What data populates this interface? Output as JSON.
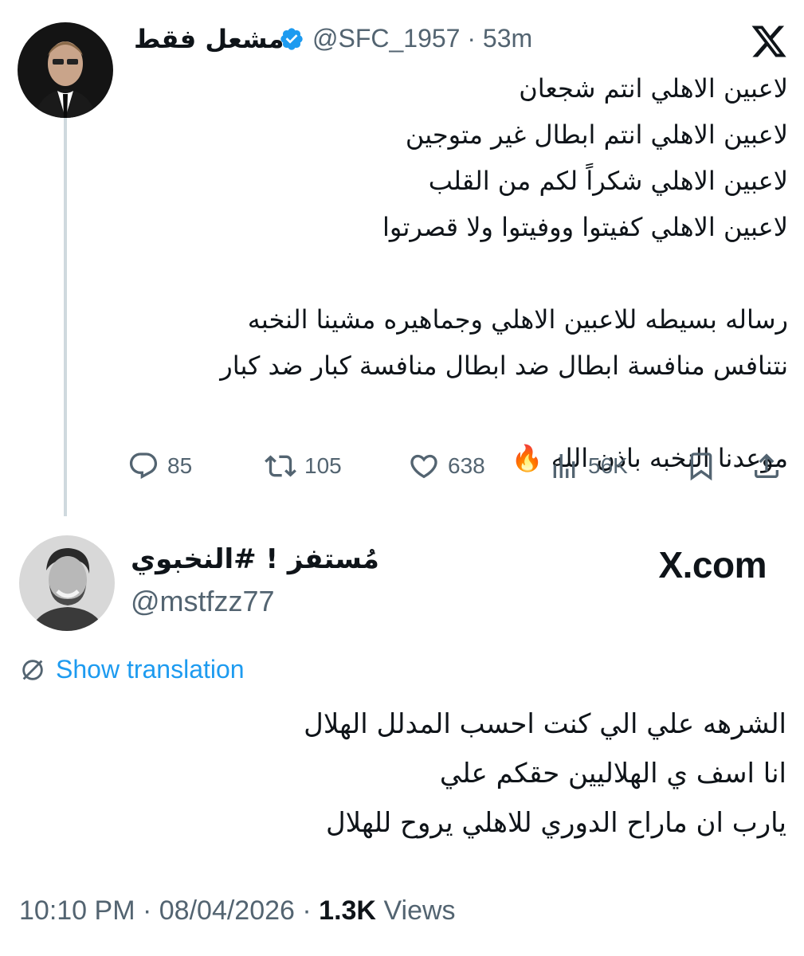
{
  "quoted_tweet": {
    "author_name": "مشعل فقط",
    "handle": "@SFC_1957",
    "separator": "·",
    "time": "53m",
    "text": "لاعبين الاهلي انتم شجعان\nلاعبين الاهلي انتم ابطال غير متوجين\nلاعبين الاهلي شكراً لكم من القلب\nلاعبين الاهلي كفيتوا ووفيتوا ولا قصرتوا\n\nرساله بسيطه للاعبين الاهلي وجماهيره مشينا النخبه\nنتنافس منافسة ابطال ضد ابطال منافسة كبار ضد كبار\n\nموعدنا النخبه باذن الله 🔥",
    "stats": {
      "replies": "85",
      "reposts": "105",
      "likes": "638",
      "views": "56K"
    }
  },
  "reply_tweet": {
    "author_name": "مُستفز ! #النخبوي",
    "handle": "@mstfzz77",
    "brand": "X.com",
    "translate_label": "Show translation",
    "text": "الشرهه علي الي كنت احسب المدلل الهلال\nانا اسف ي الهلاليين حقكم علي\nيارب ان ماراح الدوري للاهلي يروح للهلال",
    "time": "10:10 PM",
    "separator": "·",
    "date": "08/04/2026",
    "views_count": "1.3K",
    "views_label": "Views"
  },
  "colors": {
    "text": "#0f1419",
    "muted": "#536471",
    "accent": "#1d9bf0",
    "thread_line": "#cfd9de"
  },
  "icons": [
    "x-logo-icon",
    "verified-badge-icon",
    "reply-icon",
    "repost-icon",
    "like-icon",
    "views-icon",
    "bookmark-icon",
    "share-icon",
    "translate-icon"
  ]
}
